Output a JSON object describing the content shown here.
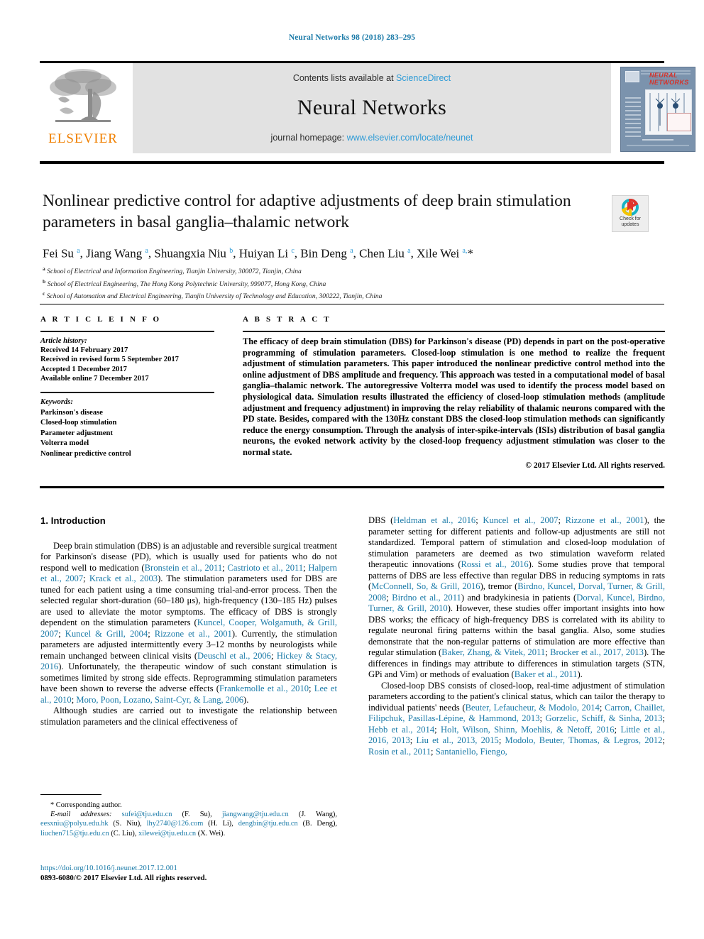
{
  "running_head": "Neural Networks 98 (2018) 283–295",
  "masthead": {
    "contents_prefix": "Contents lists available at ",
    "contents_link": "ScienceDirect",
    "journal_title": "Neural Networks",
    "homepage_prefix": "journal homepage: ",
    "homepage_url": "www.elsevier.com/locate/neunet",
    "publisher_logo_text": "ELSEVIER",
    "cover_title_line1": "NEURAL",
    "cover_title_line2": "NETWORKS"
  },
  "article": {
    "title": "Nonlinear predictive control for adaptive adjustments of deep brain stimulation parameters in basal ganglia–thalamic network",
    "authors_html": "Fei Su <sup>a</sup>, Jiang Wang <sup>a</sup>, Shuangxia Niu <sup>b</sup>, Huiyan Li <sup>c</sup>, Bin Deng <sup>a</sup>, Chen Liu <sup>a</sup>, Xile Wei <sup>a,</sup>*",
    "affiliations": [
      {
        "mark": "a",
        "text": "School of Electrical and Information Engineering, Tianjin University, 300072, Tianjin, China"
      },
      {
        "mark": "b",
        "text": "School of Electrical Engineering, The Hong Kong Polytechnic University, 999077, Hong Kong, China"
      },
      {
        "mark": "c",
        "text": "School of Automation and Electrical Engineering, Tianjin University of Technology and Education, 300222, Tianjin, China"
      }
    ]
  },
  "crossmark": {
    "line1": "Check for",
    "line2": "updates",
    "colors": {
      "red": "#e0342b",
      "yellow": "#f5c400",
      "teal": "#17b3c3",
      "blue": "#1a7aa8"
    }
  },
  "info": {
    "heading": "A R T I C L E   I N F O",
    "history_label": "Article history:",
    "history": [
      "Received 14 February 2017",
      "Received in revised form 5 September 2017",
      "Accepted 1 December 2017",
      "Available online 7 December 2017"
    ],
    "keywords_label": "Keywords:",
    "keywords": [
      "Parkinson's disease",
      "Closed-loop stimulation",
      "Parameter adjustment",
      "Volterra model",
      "Nonlinear predictive control"
    ]
  },
  "abstract": {
    "heading": "A B S T R A C T",
    "text": "The efficacy of deep brain stimulation (DBS) for Parkinson's disease (PD) depends in part on the post-operative programming of stimulation parameters. Closed-loop stimulation is one method to realize the frequent adjustment of stimulation parameters. This paper introduced the nonlinear predictive control method into the online adjustment of DBS amplitude and frequency. This approach was tested in a computational model of basal ganglia–thalamic network. The autoregressive Volterra model was used to identify the process model based on physiological data. Simulation results illustrated the efficiency of closed-loop stimulation methods (amplitude adjustment and frequency adjustment) in improving the relay reliability of thalamic neurons compared with the PD state. Besides, compared with the 130Hz constant DBS the closed-loop stimulation methods can significantly reduce the energy consumption. Through the analysis of inter-spike-intervals (ISIs) distribution of basal ganglia neurons, the evoked network activity by the closed-loop frequency adjustment stimulation was closer to the normal state.",
    "copyright": "© 2017 Elsevier Ltd. All rights reserved."
  },
  "body": {
    "section_title": "1. Introduction",
    "left_paragraphs": [
      "Deep brain stimulation (DBS) is an adjustable and reversible surgical treatment for Parkinson's disease (PD), which is usually used for patients who do not respond well to medication (<span class=\"cit\">Bronstein et al., 2011</span>; <span class=\"cit\">Castrioto et al., 2011</span>; <span class=\"cit\">Halpern et al., 2007</span>; <span class=\"cit\">Krack et al., 2003</span>). The stimulation parameters used for DBS are tuned for each patient using a time consuming trial-and-error process. Then the selected regular short-duration (60–180 &mu;s), high-frequency (130–185 Hz) pulses are used to alleviate the motor symptoms. The efficacy of DBS is strongly dependent on the stimulation parameters (<span class=\"cit\">Kuncel, Cooper, Wolgamuth, &amp; Grill, 2007</span>; <span class=\"cit\">Kuncel &amp; Grill, 2004</span>; <span class=\"cit\">Rizzone et al., 2001</span>). Currently, the stimulation parameters are adjusted intermittently every 3–12 months by neurologists while remain unchanged between clinical visits (<span class=\"cit\">Deuschl et al., 2006</span>; <span class=\"cit\">Hickey &amp; Stacy, 2016</span>). Unfortunately, the therapeutic window of such constant stimulation is sometimes limited by strong side effects. Reprogramming stimulation parameters have been shown to reverse the adverse effects (<span class=\"cit\">Frankemolle et al., 2010</span>; <span class=\"cit\">Lee et al., 2010</span>; <span class=\"cit\">Moro, Poon, Lozano, Saint-Cyr, &amp; Lang, 2006</span>).",
      "Although studies are carried out to investigate the relationship between stimulation parameters and the clinical effectiveness of"
    ],
    "right_paragraphs": [
      "DBS (<span class=\"cit\">Heldman et al., 2016</span>; <span class=\"cit\">Kuncel et al., 2007</span>; <span class=\"cit\">Rizzone et al., 2001</span>), the parameter setting for different patients and follow-up adjustments are still not standardized. Temporal pattern of stimulation and closed-loop modulation of stimulation parameters are deemed as two stimulation waveform related therapeutic innovations (<span class=\"cit\">Rossi et al., 2016</span>). Some studies prove that temporal patterns of DBS are less effective than regular DBS in reducing symptoms in rats (<span class=\"cit\">McConnell, So, &amp; Grill, 2016</span>), tremor (<span class=\"cit\">Birdno, Kuncel, Dorval, Turner, &amp; Grill, 2008</span>; <span class=\"cit\">Birdno et al., 2011</span>) and bradykinesia in patients (<span class=\"cit\">Dorval, Kuncel, Birdno, Turner, &amp; Grill, 2010</span>). However, these studies offer important insights into how DBS works; the efficacy of high-frequency DBS is correlated with its ability to regulate neuronal firing patterns within the basal ganglia. Also, some studies demonstrate that the non-regular patterns of stimulation are more effective than regular stimulation (<span class=\"cit\">Baker, Zhang, &amp; Vitek, 2011</span>; <span class=\"cit\">Brocker et al., 2017, 2013</span>). The differences in findings may attribute to differences in stimulation targets (STN, GPi and Vim) or methods of evaluation (<span class=\"cit\">Baker et al., 2011</span>).",
      "Closed-loop DBS consists of closed-loop, real-time adjustment of stimulation parameters according to the patient's clinical status, which can tailor the therapy to individual patients' needs (<span class=\"cit\">Beuter, Lefaucheur, &amp; Modolo, 2014</span>; <span class=\"cit\">Carron, Chaillet, Filipchuk, Pasillas-Lépine, &amp; Hammond, 2013</span>; <span class=\"cit\">Gorzelic, Schiff, &amp; Sinha, 2013</span>; <span class=\"cit\">Hebb et al., 2014</span>; <span class=\"cit\">Holt, Wilson, Shinn, Moehlis, &amp; Netoff, 2016</span>; <span class=\"cit\">Little et al., 2016, 2013</span>; <span class=\"cit\">Liu et al., 2013, 2015</span>; <span class=\"cit\">Modolo, Beuter, Thomas, &amp; Legros, 2012</span>; <span class=\"cit\">Rosin et al., 2011</span>; <span class=\"cit\">Santaniello, Fiengo,</span>"
    ]
  },
  "footnotes": {
    "corresponding": "* Corresponding author.",
    "emails_label": "E-mail addresses:",
    "emails_html": "<span class=\"cit\">sufei@tju.edu.cn</span> (F. Su), <span class=\"cit\">jiangwang@tju.edu.cn</span> (J. Wang), <span class=\"cit\">eesxniu@polyu.edu.hk</span> (S. Niu), <span class=\"cit\">lhy2740@126.com</span> (H. Li), <span class=\"cit\">dengbin@tju.edu.cn</span> (B. Deng), <span class=\"cit\">liuchen715@tju.edu.cn</span> (C. Liu), <span class=\"cit\">xilewei@tju.edu.cn</span> (X. Wei)."
  },
  "doi_block": {
    "doi": "https://doi.org/10.1016/j.neunet.2017.12.001",
    "issn_line": "0893-6080/© 2017 Elsevier Ltd. All rights reserved."
  }
}
